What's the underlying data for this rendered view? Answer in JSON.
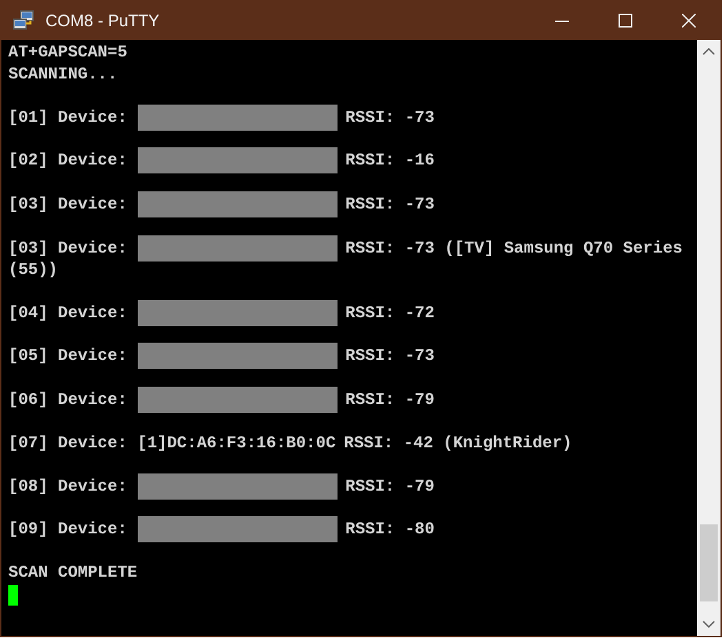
{
  "window": {
    "title": "COM8 - PuTTY"
  },
  "terminal": {
    "lines": [
      {
        "kind": "text",
        "text": "AT+GAPSCAN=5"
      },
      {
        "kind": "text",
        "text": "SCANNING..."
      },
      {
        "kind": "blank"
      },
      {
        "kind": "device",
        "label": "[01] Device:",
        "redacted": true,
        "rssi": "RSSI: -73"
      },
      {
        "kind": "blank"
      },
      {
        "kind": "device",
        "label": "[02] Device:",
        "redacted": true,
        "rssi": "RSSI: -16"
      },
      {
        "kind": "blank"
      },
      {
        "kind": "device",
        "label": "[03] Device:",
        "redacted": true,
        "rssi": "RSSI: -73"
      },
      {
        "kind": "blank"
      },
      {
        "kind": "device",
        "label": "[03] Device:",
        "redacted": true,
        "rssi": "RSSI: -73 ([TV] Samsung Q70 Series"
      },
      {
        "kind": "text",
        "text": "(55))"
      },
      {
        "kind": "blank"
      },
      {
        "kind": "device",
        "label": "[04] Device:",
        "redacted": true,
        "rssi": "RSSI: -72"
      },
      {
        "kind": "blank"
      },
      {
        "kind": "device",
        "label": "[05] Device:",
        "redacted": true,
        "rssi": "RSSI: -73"
      },
      {
        "kind": "blank"
      },
      {
        "kind": "device",
        "label": "[06] Device:",
        "redacted": true,
        "rssi": "RSSI: -79"
      },
      {
        "kind": "blank"
      },
      {
        "kind": "device",
        "label": "[07] Device:",
        "redacted": false,
        "address": "[1]DC:A6:F3:16:B0:0C",
        "rssi": "RSSI: -42 (KnightRider)"
      },
      {
        "kind": "blank"
      },
      {
        "kind": "device",
        "label": "[08] Device:",
        "redacted": true,
        "rssi": "RSSI: -79"
      },
      {
        "kind": "blank"
      },
      {
        "kind": "device",
        "label": "[09] Device:",
        "redacted": true,
        "rssi": "RSSI: -80"
      },
      {
        "kind": "blank"
      },
      {
        "kind": "text",
        "text": "SCAN COMPLETE"
      },
      {
        "kind": "cursor"
      }
    ]
  }
}
